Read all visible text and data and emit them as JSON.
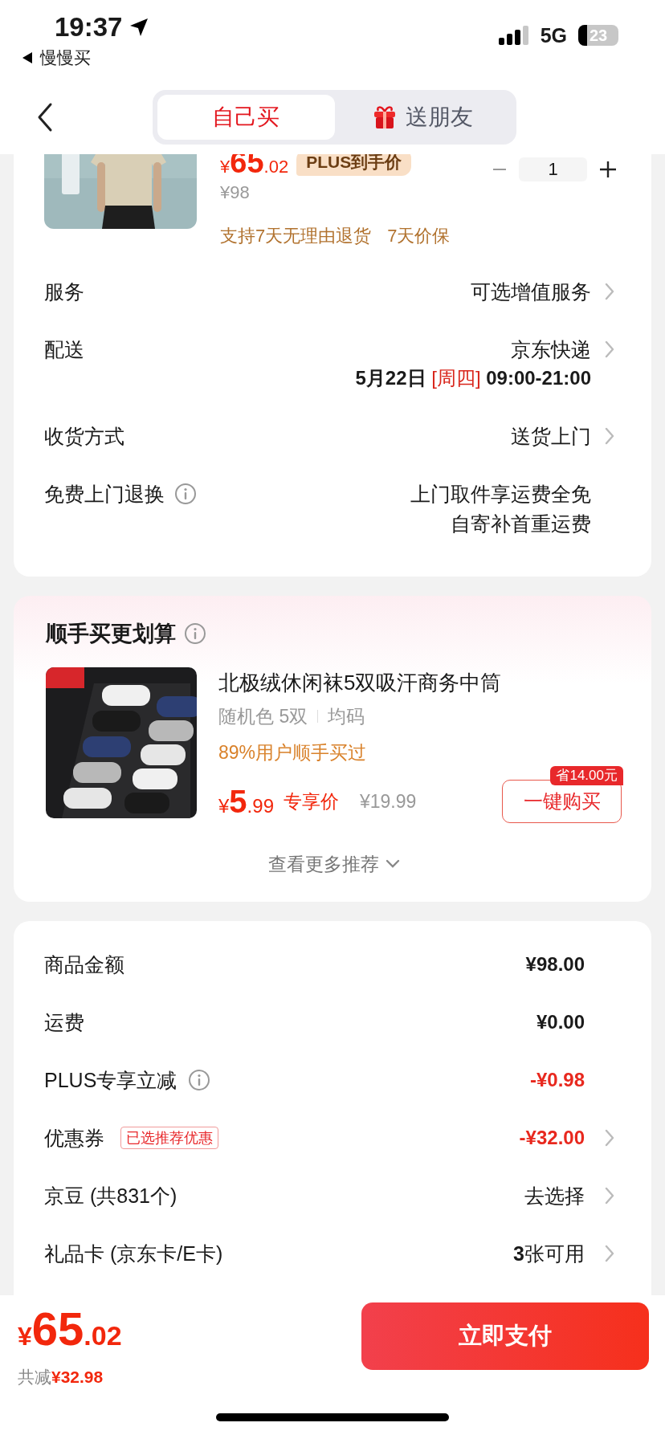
{
  "status_bar": {
    "time": "19:37",
    "back_app": "慢慢买",
    "network": "5G",
    "battery": "23"
  },
  "nav": {
    "tabs": [
      {
        "label": "自己买",
        "selected": true,
        "kind": "plain"
      },
      {
        "label": "送朋友",
        "selected": false,
        "kind": "gift"
      }
    ]
  },
  "product": {
    "price": {
      "currency": "¥",
      "integer": "65",
      "fraction": ".02"
    },
    "price_badge": "PLUS到手价",
    "original_price": "¥98",
    "quantity": "1",
    "guarantees": [
      "支持7天无理由退货",
      "7天价保"
    ]
  },
  "order_rows": [
    {
      "kind": "single",
      "label": "服务",
      "info": false,
      "value": "可选增值服务",
      "chevron": true
    },
    {
      "kind": "delivery",
      "label": "配送",
      "info": false,
      "value": "京东快递",
      "chevron": true,
      "date": "5月22日",
      "weekday": "[周四]",
      "hours": "09:00-21:00"
    },
    {
      "kind": "single",
      "label": "收货方式",
      "info": false,
      "value": "送货上门",
      "chevron": true
    },
    {
      "kind": "multi",
      "label": "免费上门退换",
      "info": true,
      "lines": [
        "上门取件享运费全免",
        "自寄补首重运费"
      ],
      "chevron": false
    }
  ],
  "recommend": {
    "title": "顺手买更划算",
    "item": {
      "name": "北极绒休闲袜5双吸汗商务中筒",
      "specs": [
        "随机色 5双",
        "均码"
      ],
      "social_proof": "89%用户顺手买过",
      "price": {
        "currency": "¥",
        "integer": "5",
        "fraction": ".99"
      },
      "price_label": "专享价",
      "original_price": "¥19.99",
      "saving": "省14.00元",
      "button": "一键购买"
    },
    "more": "查看更多推荐"
  },
  "summary": [
    {
      "label": "商品金额",
      "info": false,
      "value": "¥98.00",
      "kind": "amount",
      "chevron": false
    },
    {
      "label": "运费",
      "info": false,
      "value": "¥0.00",
      "kind": "amount",
      "chevron": false
    },
    {
      "label": "PLUS专享立减",
      "info": true,
      "value": "-¥0.98",
      "kind": "discount",
      "chevron": false
    },
    {
      "label": "优惠券",
      "info": false,
      "tag": "已选推荐优惠",
      "value": "-¥32.00",
      "kind": "discount",
      "chevron": true
    },
    {
      "label": "京豆 (共831个)",
      "info": false,
      "value": "去选择",
      "kind": "plain",
      "chevron": true
    },
    {
      "label": "礼品卡 (京东卡/E卡)",
      "info": false,
      "value": "**3**张可用",
      "kind": "plain",
      "chevron": true
    }
  ],
  "footer": {
    "total": {
      "currency": "¥",
      "integer": "65",
      "fraction": ".02"
    },
    "saved_label": "共减",
    "saved_amount": "¥32.98",
    "pay_button": "立即支付"
  }
}
